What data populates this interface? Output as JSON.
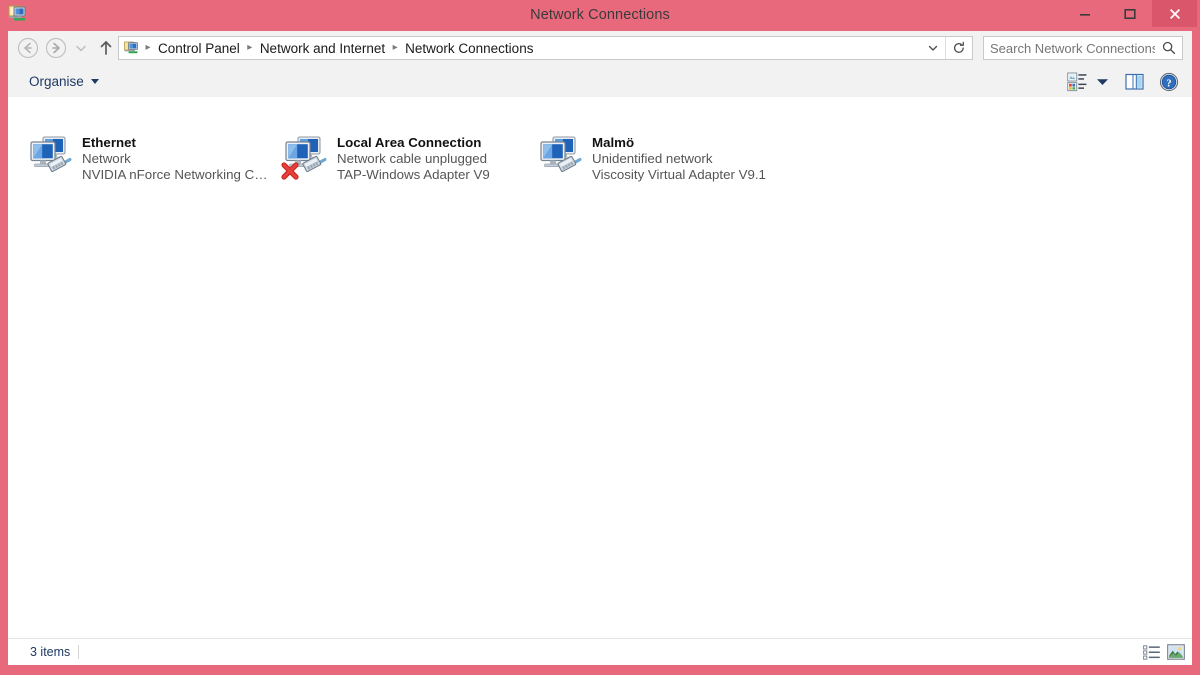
{
  "window": {
    "title": "Network Connections",
    "icon": "network-connections-icon",
    "accent_color": "#e9697c",
    "close_button_color": "#d9566b",
    "controls": {
      "minimize_label": "Minimize",
      "maximize_label": "Maximize",
      "close_label": "Close"
    }
  },
  "navbar": {
    "back_label": "Back",
    "forward_label": "Forward",
    "history_label": "Recent locations",
    "up_label": "Up one level",
    "breadcrumb_icon": "network-connections-icon",
    "breadcrumbs": [
      "Control Panel",
      "Network and Internet",
      "Network Connections"
    ],
    "separator": "▸",
    "address_chevron_label": "Previous locations",
    "refresh_label": "Refresh"
  },
  "search": {
    "value": "",
    "placeholder": "Search Network Connections",
    "icon": "search-icon"
  },
  "toolbar": {
    "organise_label": "Organise",
    "view_label": "Change your view",
    "view_caret_label": "More options",
    "preview_pane_label": "Show the preview pane",
    "help_label": "Help"
  },
  "connections": [
    {
      "name": "Ethernet",
      "status": "Network",
      "device": "NVIDIA nForce Networking Contr...",
      "disconnected": false,
      "icon": "network-adapter-icon"
    },
    {
      "name": "Local Area Connection",
      "status": "Network cable unplugged",
      "device": "TAP-Windows Adapter V9",
      "disconnected": true,
      "icon": "network-adapter-icon"
    },
    {
      "name": "Malmö",
      "status": "Unidentified network",
      "device": "Viscosity Virtual Adapter V9.1",
      "disconnected": false,
      "icon": "network-adapter-icon"
    }
  ],
  "statusbar": {
    "item_count": "3 items",
    "details_view_label": "Details view",
    "icons_view_label": "Large icons view"
  }
}
